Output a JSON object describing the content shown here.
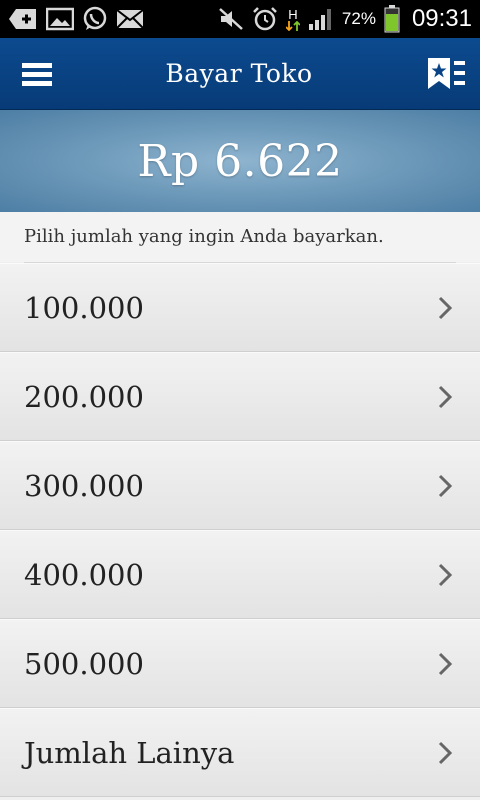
{
  "status_bar": {
    "battery_percent": "72%",
    "time": "09:31",
    "network": "H",
    "icons": [
      "add-icon",
      "image-icon",
      "whatsapp-icon",
      "email-icon",
      "mute-icon",
      "alarm-icon",
      "network-h-icon",
      "signal-icon",
      "battery-icon"
    ]
  },
  "appbar": {
    "title": "Bayar Toko",
    "menu_icon": "hamburger-icon",
    "bookmark_icon": "bookmark-list-icon"
  },
  "balance": {
    "amount": "Rp 6.622"
  },
  "instruction": "Pilih jumlah yang ingin Anda bayarkan.",
  "options": [
    {
      "label": "100.000"
    },
    {
      "label": "200.000"
    },
    {
      "label": "300.000"
    },
    {
      "label": "400.000"
    },
    {
      "label": "500.000"
    },
    {
      "label": "Jumlah Lainya"
    }
  ],
  "colors": {
    "appbar": "#0c4a8f",
    "banner": "#6f9bbb",
    "list_bg": "#ececec",
    "battery": "#7ec62b"
  }
}
